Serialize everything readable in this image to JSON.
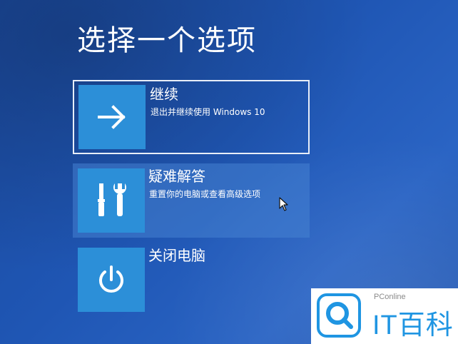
{
  "screen": {
    "title": "选择一个选项"
  },
  "options": [
    {
      "title": "继续",
      "description": "退出并继续使用 Windows 10",
      "icon": "arrow-right-icon",
      "state": "selected"
    },
    {
      "title": "疑难解答",
      "description": "重置你的电脑或查看高级选项",
      "icon": "tools-icon",
      "state": "hovered"
    },
    {
      "title": "关闭电脑",
      "description": "",
      "icon": "power-icon",
      "state": "normal"
    }
  ],
  "watermark": {
    "brand_small": "PConline",
    "brand_main": "IT百科",
    "icon": "search-logo-icon",
    "color": "#1f95e2"
  },
  "colors": {
    "background": "#1f56b4",
    "tile": "#2c8fd8",
    "text": "#ffffff"
  }
}
